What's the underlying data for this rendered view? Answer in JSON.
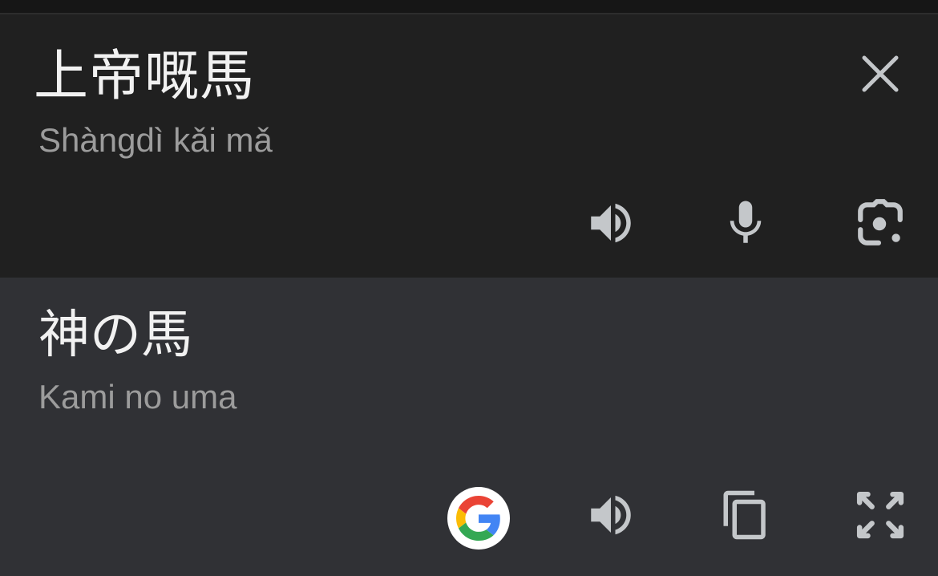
{
  "source": {
    "text": "上帝嘅馬",
    "transliteration": "Shàngdì kǎi mǎ",
    "icons": [
      "close-icon",
      "speaker-icon",
      "microphone-icon",
      "camera-lens-icon"
    ]
  },
  "translation": {
    "text": "神の馬",
    "transliteration": "Kami no uma",
    "icons": [
      "google-icon",
      "speaker-icon",
      "copy-icon",
      "fullscreen-icon"
    ]
  },
  "colors": {
    "source_bg": "#202020",
    "target_bg": "#303135",
    "text_primary": "#f1f1f1",
    "text_secondary": "#9c9c9c",
    "icon_color": "#c4c7ca"
  }
}
